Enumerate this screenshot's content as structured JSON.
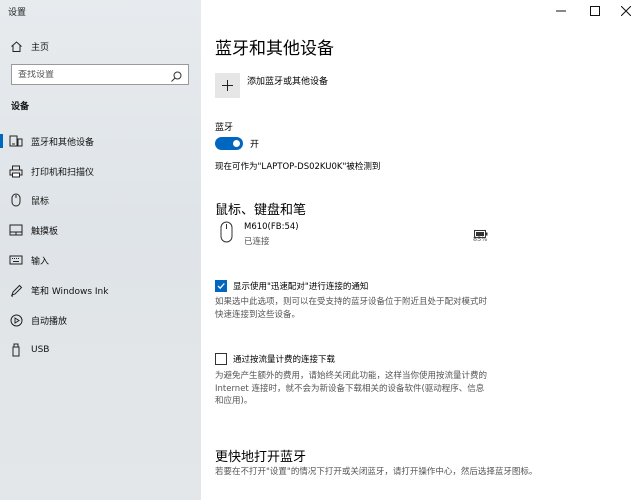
{
  "window": {
    "title": "设置"
  },
  "sidebar": {
    "home_label": "主页",
    "search_placeholder": "查找设置",
    "section_heading": "设备",
    "items": [
      {
        "label": "蓝牙和其他设备",
        "icon": "bluetooth-devices-icon",
        "active": true
      },
      {
        "label": "打印机和扫描仪",
        "icon": "printer-icon"
      },
      {
        "label": "鼠标",
        "icon": "mouse-icon"
      },
      {
        "label": "触摸板",
        "icon": "touchpad-icon"
      },
      {
        "label": "输入",
        "icon": "keyboard-icon"
      },
      {
        "label": "笔和 Windows Ink",
        "icon": "pen-icon"
      },
      {
        "label": "自动播放",
        "icon": "autoplay-icon"
      },
      {
        "label": "USB",
        "icon": "usb-icon"
      }
    ]
  },
  "main": {
    "title": "蓝牙和其他设备",
    "add_device_label": "添加蓝牙或其他设备",
    "bluetooth": {
      "heading": "蓝牙",
      "toggle_label": "开",
      "toggle_on": true,
      "discoverable_text": "现在可作为\"LAPTOP-DS02KU0K\"被检测到"
    },
    "mouse_section": {
      "heading": "鼠标、键盘和笔",
      "device": {
        "name": "M610(FB:54)",
        "status": "已连接",
        "battery": "85%",
        "battery_level": 0.85
      }
    },
    "swift_pair": {
      "label": "显示使用\"迅速配对\"进行连接的通知",
      "checked": true,
      "desc_lines": [
        "如果选中此选项，则可以在受支持的蓝牙设备位于附近且处于配对模式时",
        "快速连接到这些设备。"
      ]
    },
    "metered": {
      "label": "通过按流量计费的连接下载",
      "checked": false,
      "desc_lines": [
        "为避免产生额外的费用，请始终关闭此功能，这样当你使用按流量计费的",
        "Internet 连接时，就不会为新设备下载相关的设备软件(驱动程序、信息",
        "和应用)。"
      ]
    },
    "quick_open": {
      "heading": "更快地打开蓝牙",
      "desc": "若要在不打开\"设置\"的情况下打开或关闭蓝牙，请打开操作中心，然后选择蓝牙图标。"
    }
  },
  "colors": {
    "accent": "#0067c0",
    "sidebar_bg": "#e4e7ea",
    "tile_bg": "#e6e6e6"
  }
}
